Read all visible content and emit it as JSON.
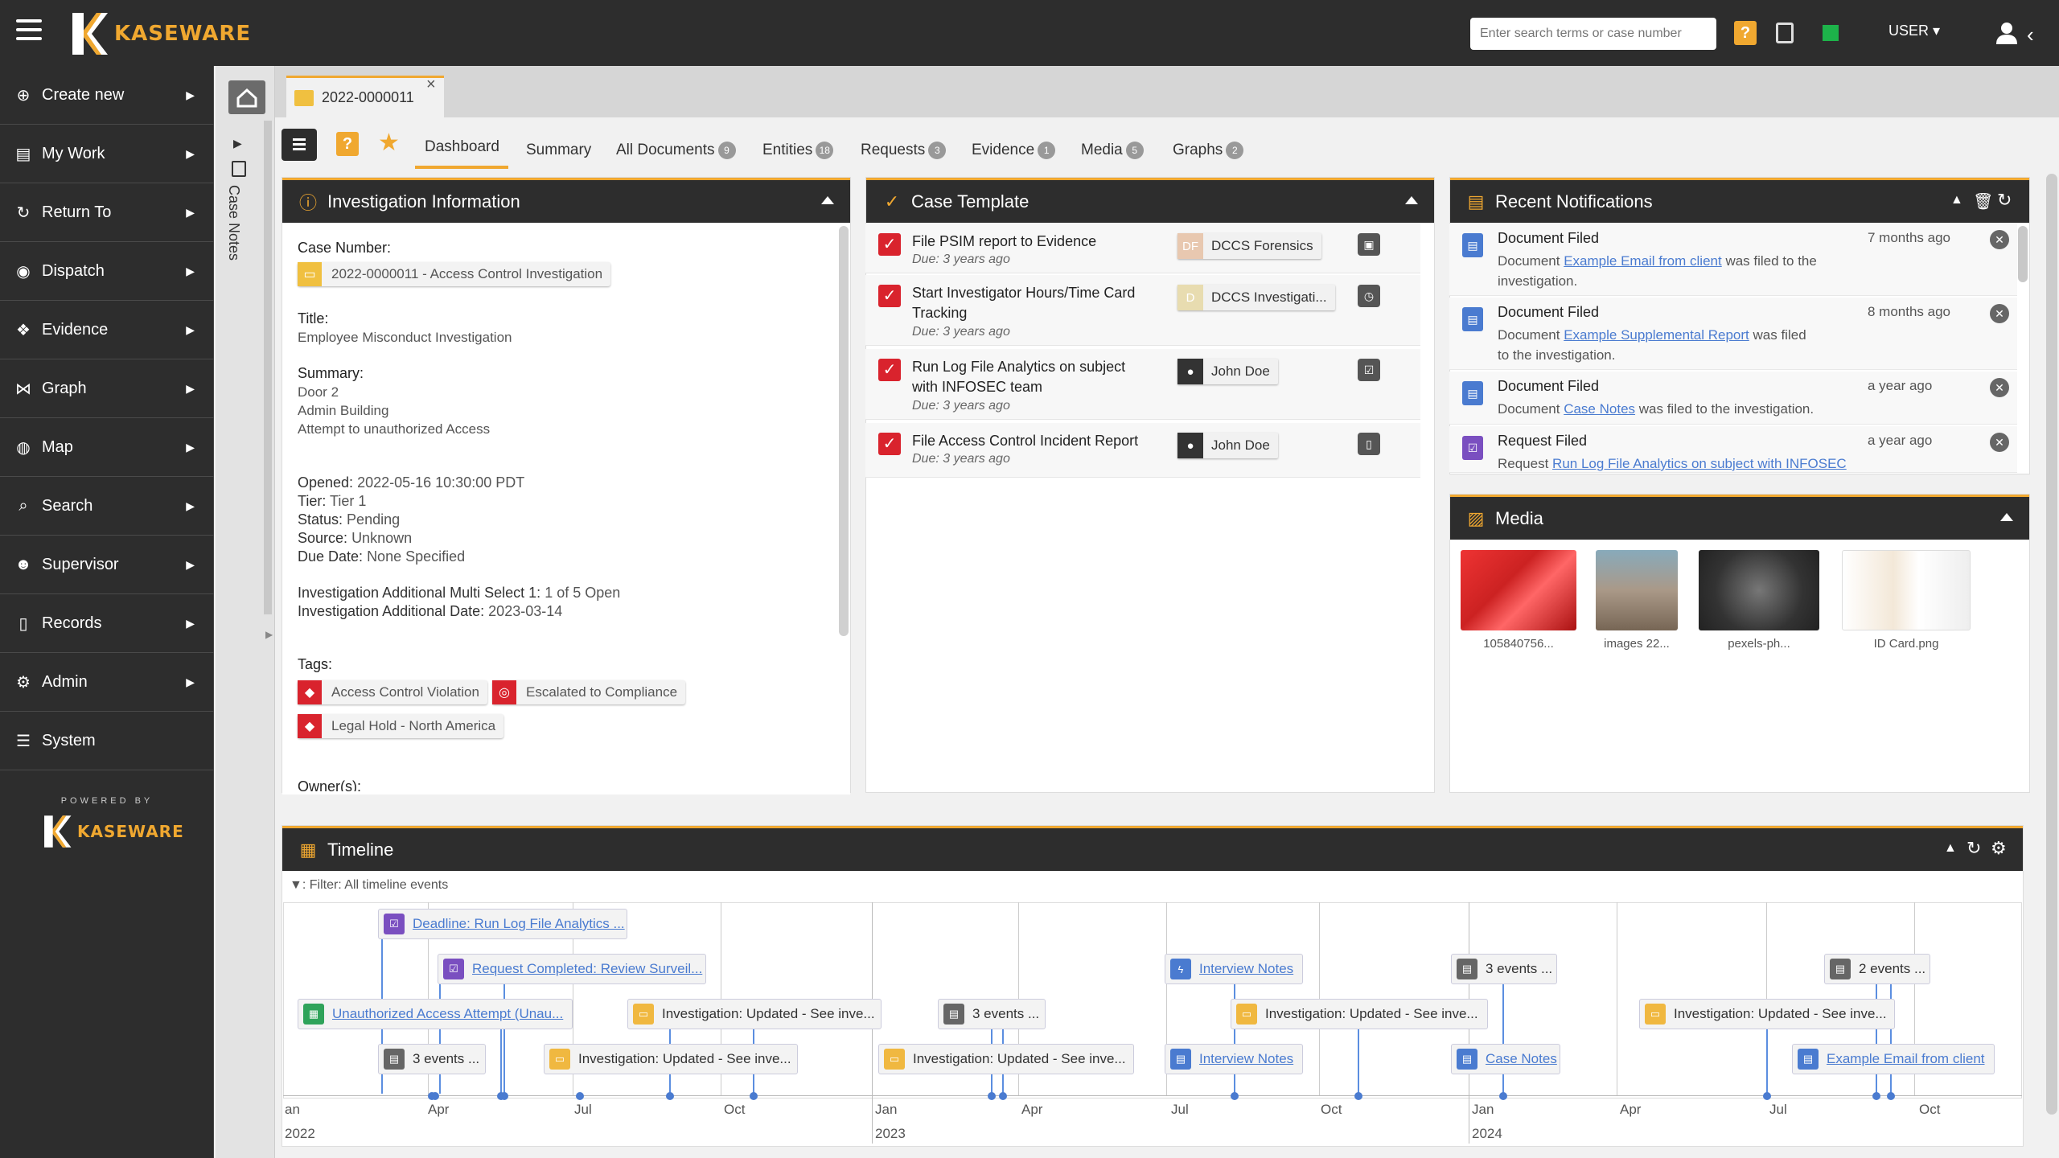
{
  "header": {
    "logo_text": "KASEWARE",
    "search_placeholder": "Enter search terms or case number",
    "user_label": "USER",
    "help_icon": "question-icon"
  },
  "sidebar": {
    "items": [
      {
        "label": "Create new",
        "icon": "plus-circle-icon"
      },
      {
        "label": "My Work",
        "icon": "briefcase-icon"
      },
      {
        "label": "Return To",
        "icon": "refresh-icon"
      },
      {
        "label": "Dispatch",
        "icon": "dispatch-icon"
      },
      {
        "label": "Evidence",
        "icon": "cubes-icon"
      },
      {
        "label": "Graph",
        "icon": "graph-icon"
      },
      {
        "label": "Map",
        "icon": "globe-icon"
      },
      {
        "label": "Search",
        "icon": "search-icon"
      },
      {
        "label": "Supervisor",
        "icon": "users-icon"
      },
      {
        "label": "Records",
        "icon": "file-icon"
      },
      {
        "label": "Admin",
        "icon": "gears-icon"
      },
      {
        "label": "System",
        "icon": "list-icon"
      }
    ],
    "powered_by": "POWERED BY",
    "logo_text": "KASEWARE"
  },
  "case_notes_label": "Case Notes",
  "open_tab": {
    "label": "2022-0000011"
  },
  "subtabs": [
    {
      "label": "Dashboard",
      "count": ""
    },
    {
      "label": "Summary",
      "count": ""
    },
    {
      "label": "All Documents",
      "count": "9"
    },
    {
      "label": "Entities",
      "count": "18"
    },
    {
      "label": "Requests",
      "count": "3"
    },
    {
      "label": "Evidence",
      "count": "1"
    },
    {
      "label": "Media",
      "count": "5"
    },
    {
      "label": "Graphs",
      "count": "2"
    }
  ],
  "investigation": {
    "title": "Investigation Information",
    "case_number_label": "Case Number:",
    "case_number": "2022-0000011 - Access Control Investigation",
    "title_label": "Title:",
    "title_value": "Employee Misconduct Investigation",
    "summary_label": "Summary:",
    "summary_lines": [
      "Door 2",
      "Admin Building",
      "Attempt to unauthorized Access"
    ],
    "opened_label": "Opened:",
    "opened": "2022-05-16 10:30:00 PDT",
    "tier_label": "Tier:",
    "tier": "Tier 1",
    "status_label": "Status:",
    "status": "Pending",
    "source_label": "Source:",
    "source": "Unknown",
    "due_label": "Due Date:",
    "due": "None Specified",
    "multi_label": "Investigation Additional Multi Select 1:",
    "multi": "1 of 5 Open",
    "date_label": "Investigation Additional Date:",
    "date": "2023-03-14",
    "tags_label": "Tags:",
    "tags": [
      "Access Control Violation",
      "Escalated to Compliance",
      "Legal Hold - North America"
    ],
    "owners_label": "Owner(s):"
  },
  "case_template": {
    "title": "Case Template",
    "rows": [
      {
        "title": "File PSIM report to Evidence",
        "due": "Due: 3 years ago",
        "assignee": "DCCS Forensics",
        "avatar": "DF",
        "action_icon": "evidence-icon"
      },
      {
        "title": "Start Investigator Hours/Time Card Tracking",
        "due": "Due: 3 years ago",
        "assignee": "DCCS Investigati...",
        "avatar": "D",
        "action_icon": "clock-icon"
      },
      {
        "title": "Run Log File Analytics on subject with INFOSEC team",
        "due": "Due: 3 years ago",
        "assignee": "John Doe",
        "avatar": "",
        "action_icon": "checkbox-icon"
      },
      {
        "title": "File Access Control Incident Report",
        "due": "Due: 3 years ago",
        "assignee": "John Doe",
        "avatar": "",
        "action_icon": "door-icon"
      }
    ]
  },
  "notifications": {
    "title": "Recent Notifications",
    "items": [
      {
        "title": "Document Filed",
        "prefix": "Document ",
        "link": "Example Email from client",
        "suffix": " was filed to the investigation.",
        "time": "7 months ago"
      },
      {
        "title": "Document Filed",
        "prefix": "Document ",
        "link": "Example Supplemental Report",
        "suffix": " was filed to the investigation.",
        "time": "8 months ago"
      },
      {
        "title": "Document Filed",
        "prefix": "Document ",
        "link": "Case Notes",
        "suffix": " was filed to the investigation.",
        "time": "a year ago"
      },
      {
        "title": "Request Filed",
        "prefix": "Request ",
        "link": "Run Log File Analytics on subject with INFOSEC",
        "suffix": "",
        "time": "a year ago"
      }
    ]
  },
  "media": {
    "title": "Media",
    "items": [
      {
        "caption": "105840756..."
      },
      {
        "caption": "images 22..."
      },
      {
        "caption": "pexels-ph..."
      },
      {
        "caption": "ID Card.png"
      }
    ]
  },
  "timeline": {
    "title": "Timeline",
    "filter": ": Filter: All timeline events",
    "events": [
      {
        "label": "Deadline: Run Log File Analytics ...",
        "link": true,
        "color": "#7a4fc0"
      },
      {
        "label": "Request Completed: Review Surveil...",
        "link": true,
        "color": "#7a4fc0"
      },
      {
        "label": "Unauthorized Access Attempt (Unau...",
        "link": true,
        "color": "#2fa35a"
      },
      {
        "label": "3 events ...",
        "link": false,
        "color": "#666666"
      },
      {
        "label": "Investigation: Updated - See inve...",
        "link": false,
        "color": "#f0b840"
      },
      {
        "label": "Investigation: Updated - See inve...",
        "link": false,
        "color": "#f0b840"
      },
      {
        "label": "3 events ...",
        "link": false,
        "color": "#666666"
      },
      {
        "label": "Investigation: Updated - See inve...",
        "link": false,
        "color": "#f0b840"
      },
      {
        "label": "Interview Notes",
        "link": true,
        "color": "#4a7bd0"
      },
      {
        "label": "Investigation: Updated - See inve...",
        "link": false,
        "color": "#f0b840"
      },
      {
        "label": "Interview Notes",
        "link": true,
        "color": "#4a7bd0"
      },
      {
        "label": "3 events ...",
        "link": false,
        "color": "#666666"
      },
      {
        "label": "Case Notes",
        "link": true,
        "color": "#4a7bd0"
      },
      {
        "label": "2 events ...",
        "link": false,
        "color": "#666666"
      },
      {
        "label": "Investigation: Updated - See inve...",
        "link": false,
        "color": "#f0b840"
      },
      {
        "label": "Example Email from client",
        "link": true,
        "color": "#4a7bd0"
      }
    ],
    "axis_labels": [
      "an",
      "Apr",
      "Jul",
      "Oct",
      "Jan",
      "Apr",
      "Jul",
      "Oct",
      "Jan",
      "Apr",
      "Jul",
      "Oct"
    ],
    "years": [
      "2022",
      "2023",
      "2024"
    ]
  },
  "colors": {
    "accent": "#f0a830",
    "dark": "#2d2d2d",
    "link": "#4a7bd0",
    "tag_red": "#d9232d"
  }
}
